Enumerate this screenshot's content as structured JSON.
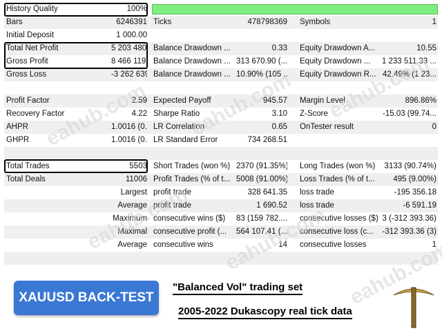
{
  "header": {
    "quality_label": "History Quality",
    "quality_value": "100%",
    "quality_fraction": 1.0
  },
  "rows": [
    [
      "Bars",
      "6246391",
      "Ticks",
      "478798369",
      "Symbols",
      "1"
    ],
    [
      "Initial Deposit",
      "1 000.00",
      "",
      "",
      "",
      ""
    ],
    [
      "Total Net Profit",
      "5 203 480.01",
      "Balance Drawdown ...",
      "0.33",
      "Equity Drawdown A...",
      "10.55"
    ],
    [
      "Gross Profit",
      "8 466 119.64",
      "Balance Drawdown ...",
      "313 670.90 (...",
      "Equity Drawdown ...",
      "1 233 511.33 ..."
    ],
    [
      "Gross Loss",
      "-3 262 639.63",
      "Balance Drawdown ...",
      "10.90% (105 ...",
      "Equity Drawdown R...",
      "42.49% (1 23..."
    ],
    [
      "",
      "",
      "",
      "",
      "",
      ""
    ],
    [
      "Profit Factor",
      "2.59",
      "Expected Payoff",
      "945.57",
      "Margin Level",
      "896.86%"
    ],
    [
      "Recovery Factor",
      "4.22",
      "Sharpe Ratio",
      "3.10",
      "Z-Score",
      "-15.03 (99.74..."
    ],
    [
      "AHPR",
      "1.0016 (0.16...",
      "LR Correlation",
      "0.65",
      "OnTester result",
      "0"
    ],
    [
      "GHPR",
      "1.0016 (0.16...",
      "LR Standard Error",
      "734 268.51",
      "",
      ""
    ],
    [
      "",
      "",
      "",
      "",
      "",
      ""
    ],
    [
      "Total Trades",
      "5503",
      "Short Trades (won %)",
      "2370 (91.35%)",
      "Long Trades (won %)",
      "3133 (90.74%)"
    ],
    [
      "Total Deals",
      "11006",
      "Profit Trades (% of t...",
      "5008 (91.00%)",
      "Loss Trades (% of t...",
      "495 (9.00%)"
    ],
    [
      "",
      "Largest",
      "profit trade",
      "328 641.35",
      "loss trade",
      "-195 356.18"
    ],
    [
      "",
      "Average",
      "profit trade",
      "1 690.52",
      "loss trade",
      "-6 591.19"
    ],
    [
      "",
      "Maximum",
      "consecutive wins ($)",
      "83 (159 782....",
      "consecutive losses ($)",
      "3 (-312 393.36)"
    ],
    [
      "",
      "Maximal",
      "consecutive profit (...",
      "564 107.41 (...",
      "consecutive loss (c...",
      "-312 393.36 (3)"
    ],
    [
      "",
      "Average",
      "consecutive wins",
      "14",
      "consecutive losses",
      "1"
    ],
    [
      "",
      "",
      "",
      "",
      "",
      ""
    ]
  ],
  "watermark": "eahub.com",
  "badge_label": "XAUUSD BACK-TEST",
  "caption_line1": "\"Balanced Vol\" trading set",
  "caption_line2": "2005-2022 Dukascopy real tick data",
  "colors": {
    "quality_bar": "#7fee7f",
    "badge": "#3a78d4",
    "row_alt": "#efefef"
  }
}
